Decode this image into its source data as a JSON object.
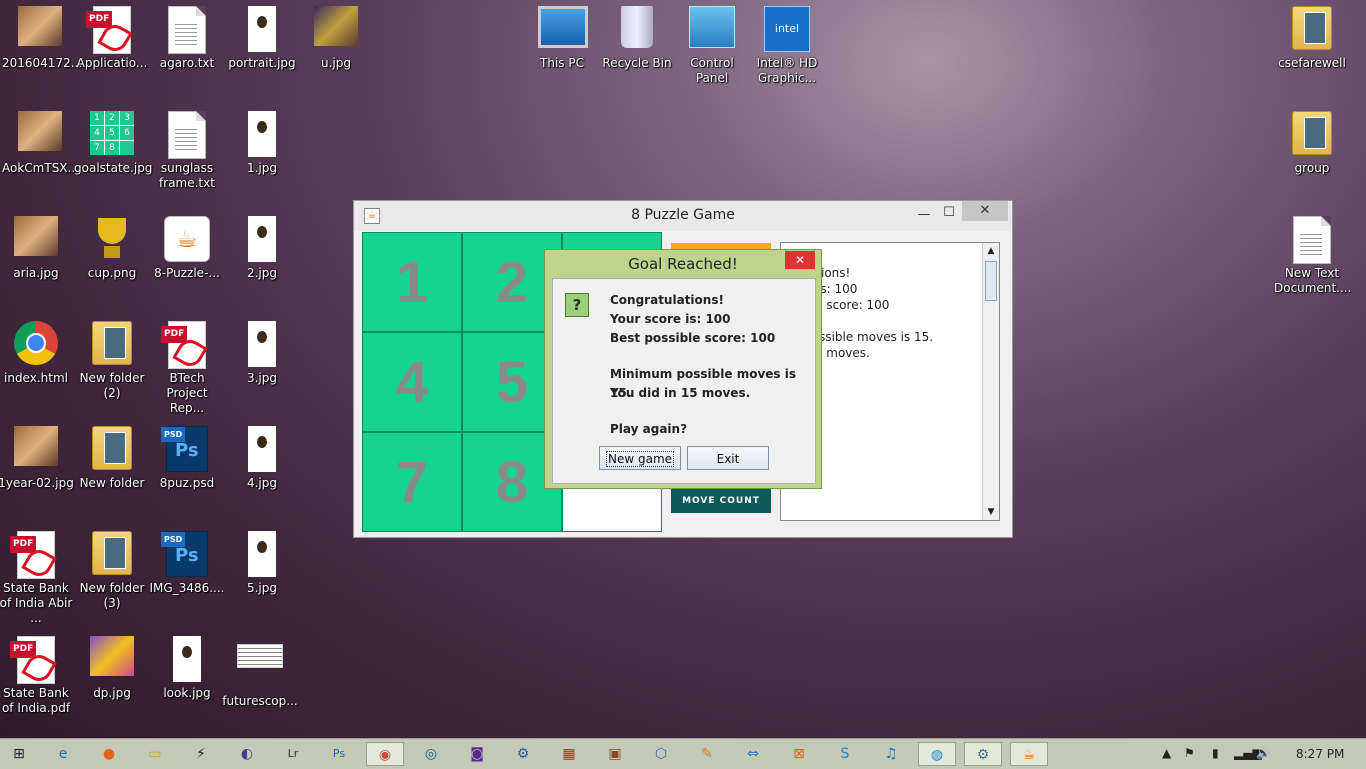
{
  "desktop": {
    "icons": [
      {
        "label": "201604172...",
        "type": "photo"
      },
      {
        "label": "Applicatio...",
        "type": "pdf"
      },
      {
        "label": "agaro.txt",
        "type": "text"
      },
      {
        "label": "portrait.jpg",
        "type": "portrait"
      },
      {
        "label": "u.jpg",
        "type": "photo"
      },
      {
        "label": "AokCmTSX...",
        "type": "photo"
      },
      {
        "label": "goalstate.jpg",
        "type": "grid"
      },
      {
        "label": "sunglass frame.txt",
        "type": "text"
      },
      {
        "label": "1.jpg",
        "type": "portrait"
      },
      {
        "label": "aria.jpg",
        "type": "photo"
      },
      {
        "label": "cup.png",
        "type": "cup"
      },
      {
        "label": "8-Puzzle-...",
        "type": "java"
      },
      {
        "label": "2.jpg",
        "type": "portrait"
      },
      {
        "label": "index.html",
        "type": "chrome"
      },
      {
        "label": "New folder (2)",
        "type": "folder"
      },
      {
        "label": "BTech Project Rep...",
        "type": "pdf"
      },
      {
        "label": "3.jpg",
        "type": "portrait"
      },
      {
        "label": "1year-02.jpg",
        "type": "photo"
      },
      {
        "label": "New folder",
        "type": "folder"
      },
      {
        "label": "8puz.psd",
        "type": "psd"
      },
      {
        "label": "4.jpg",
        "type": "portrait"
      },
      {
        "label": "State Bank of India Abir ...",
        "type": "pdf"
      },
      {
        "label": "New folder (3)",
        "type": "folder"
      },
      {
        "label": "IMG_3486....",
        "type": "psd"
      },
      {
        "label": "5.jpg",
        "type": "portrait"
      },
      {
        "label": "State Bank of India.pdf",
        "type": "pdf"
      },
      {
        "label": "dp.jpg",
        "type": "photo"
      },
      {
        "label": "look.jpg",
        "type": "portrait"
      },
      {
        "label": "futurescop...",
        "type": "textimg"
      },
      {
        "label": "This PC",
        "type": "pc"
      },
      {
        "label": "Recycle Bin",
        "type": "bin"
      },
      {
        "label": "Control Panel",
        "type": "cp"
      },
      {
        "label": "Intel® HD Graphic...",
        "type": "intel"
      },
      {
        "label": "csefarewell",
        "type": "folder"
      },
      {
        "label": "group",
        "type": "folder"
      },
      {
        "label": "New Text Document....",
        "type": "text"
      }
    ]
  },
  "window": {
    "title": "8 Puzzle Game",
    "tiles": [
      "1",
      "2",
      "",
      "4",
      "5",
      "",
      "7",
      "8",
      ""
    ],
    "move_count_label": "MOVE COUNT",
    "log": " Over!\nratulations!\nscore is: 100\nossible score: 100\n\num possible moves is 15.\nd in 15 moves."
  },
  "dialog": {
    "title": "Goal Reached!",
    "line1": "Congratulations!",
    "line2": "Your score is: 100",
    "line3": "Best possible score: 100",
    "line4": "Minimum possible moves is 15.",
    "line5": "You did in 15 moves.",
    "line6": "Play again?",
    "new_game": "New game",
    "exit": "Exit"
  },
  "taskbar": {
    "clock": "8:27 PM",
    "apps": [
      "start-icon",
      "ie-icon",
      "firefox-icon",
      "explorer-icon",
      "winamp-icon",
      "eclipse-icon",
      "lightroom-icon",
      "photoshop-icon",
      "chrome-icon",
      "media-icon",
      "app-icon",
      "python-icon",
      "office-icon",
      "photo-app-icon",
      "3d-icon",
      "app2-icon",
      "teamviewer-icon",
      "xampp-icon",
      "skype-icon",
      "itunes-icon",
      "app3-icon",
      "app4-icon",
      "java-icon"
    ]
  }
}
